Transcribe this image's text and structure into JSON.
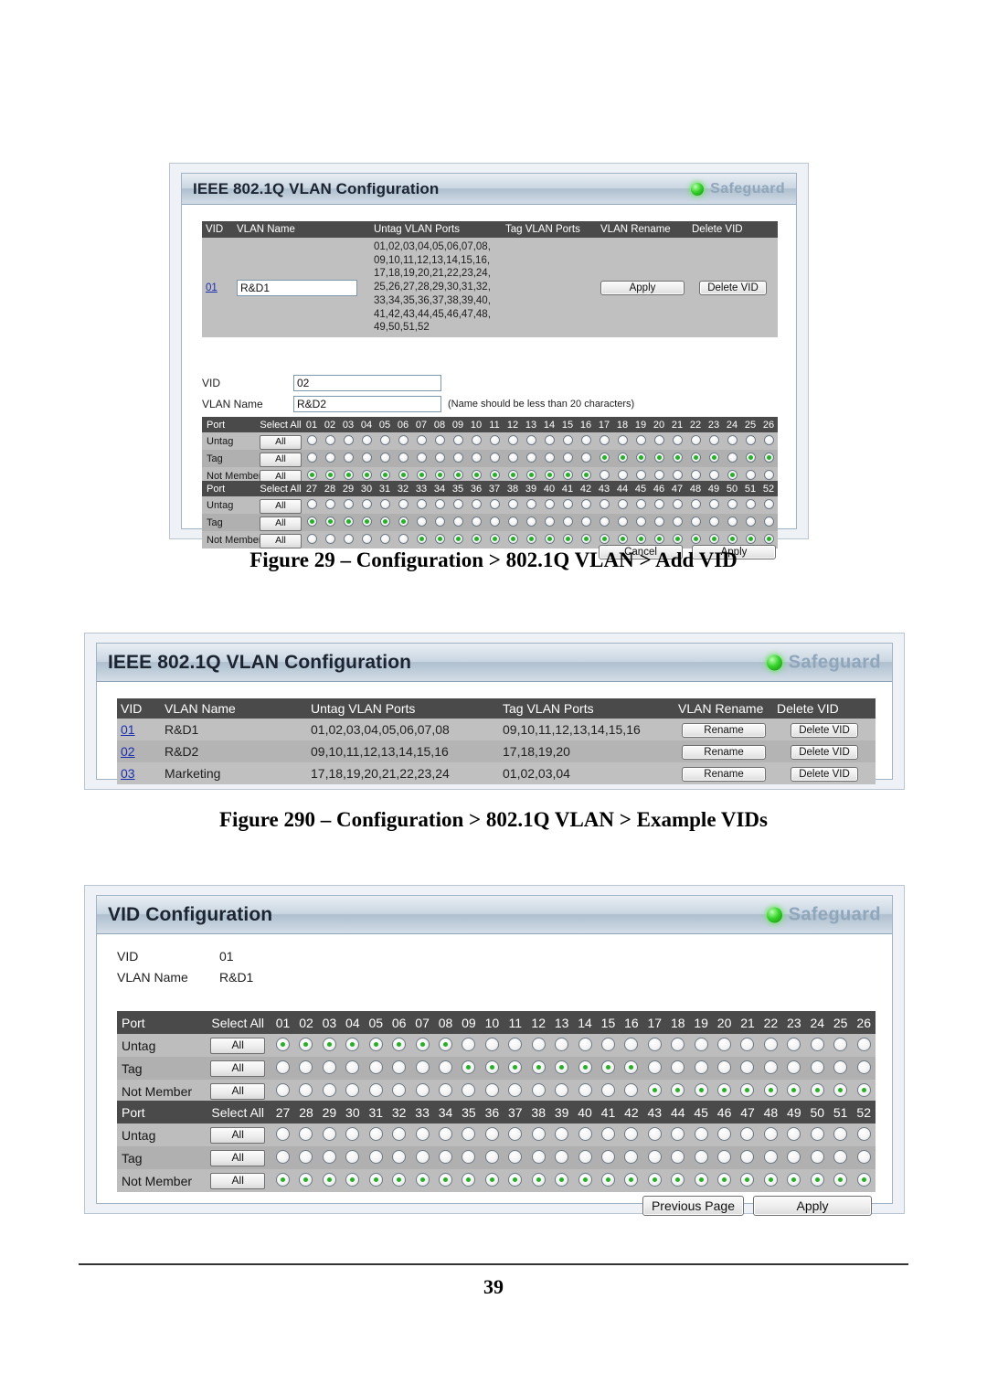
{
  "page": {
    "number": "39"
  },
  "figure1": {
    "panel": {
      "title": "IEEE 802.1Q VLAN Configuration",
      "safeguard_label": "Safeguard",
      "led_color": "#36d42a",
      "title_color": "#1b2430",
      "safeguard_text_color": "#8fa6bb"
    },
    "table": {
      "headers": [
        "VID",
        "VLAN Name",
        "Untag VLAN Ports",
        "Tag VLAN Ports",
        "VLAN Rename",
        "Delete VID"
      ],
      "rows": [
        {
          "vid": "01",
          "vlan_name_value": "R&D1",
          "untag_ports": "01,02,03,04,05,06,07,08,\n09,10,11,12,13,14,15,16,\n17,18,19,20,21,22,23,24,\n25,26,27,28,29,30,31,32,\n33,34,35,36,37,38,39,40,\n41,42,43,44,45,46,47,48,\n49,50,51,52",
          "tag_ports": "",
          "rename_label": "Apply",
          "delete_label": "Delete VID"
        }
      ]
    },
    "form": {
      "vid_label": "VID",
      "vid_value": "02",
      "vlan_name_label": "VLAN Name",
      "vlan_name_value": "R&D2",
      "name_note": "(Name should be less than 20 characters)"
    },
    "matrix": {
      "port_label": "Port",
      "select_all_label": "Select All",
      "all_button_label": "All",
      "row_labels": [
        "Untag",
        "Tag",
        "Not Member"
      ],
      "block1_ports": [
        "01",
        "02",
        "03",
        "04",
        "05",
        "06",
        "07",
        "08",
        "09",
        "10",
        "11",
        "12",
        "13",
        "14",
        "15",
        "16",
        "17",
        "18",
        "19",
        "20",
        "21",
        "22",
        "23",
        "24",
        "25",
        "26"
      ],
      "block2_ports": [
        "27",
        "28",
        "29",
        "30",
        "31",
        "32",
        "33",
        "34",
        "35",
        "36",
        "37",
        "38",
        "39",
        "40",
        "41",
        "42",
        "43",
        "44",
        "45",
        "46",
        "47",
        "48",
        "49",
        "50",
        "51",
        "52"
      ],
      "block1_selection": [
        "N",
        "N",
        "N",
        "N",
        "N",
        "N",
        "N",
        "N",
        "N",
        "N",
        "N",
        "N",
        "N",
        "N",
        "N",
        "N",
        "T",
        "T",
        "T",
        "T",
        "T",
        "T",
        "T",
        "N",
        "T",
        "T"
      ],
      "block2_selection": [
        "T",
        "T",
        "T",
        "T",
        "T",
        "T",
        "N",
        "N",
        "N",
        "N",
        "N",
        "N",
        "N",
        "N",
        "N",
        "N",
        "N",
        "N",
        "N",
        "N",
        "N",
        "N",
        "N",
        "N",
        "N",
        "N"
      ]
    },
    "buttons": {
      "cancel_label": "Cancel",
      "apply_label": "Apply"
    },
    "caption": "Figure 29 – Configuration > 802.1Q VLAN > Add VID"
  },
  "figure2": {
    "panel": {
      "title": "IEEE 802.1Q VLAN Configuration",
      "safeguard_label": "Safeguard"
    },
    "table": {
      "headers": [
        "VID",
        "VLAN Name",
        "Untag VLAN Ports",
        "Tag VLAN Ports",
        "VLAN Rename",
        "Delete VID"
      ],
      "rows": [
        {
          "vid": "01",
          "vlan_name": "R&D1",
          "untag_ports": "01,02,03,04,05,06,07,08",
          "tag_ports": "09,10,11,12,13,14,15,16",
          "rename_label": "Rename",
          "delete_label": "Delete VID"
        },
        {
          "vid": "02",
          "vlan_name": "R&D2",
          "untag_ports": "09,10,11,12,13,14,15,16",
          "tag_ports": "17,18,19,20",
          "rename_label": "Rename",
          "delete_label": "Delete VID"
        },
        {
          "vid": "03",
          "vlan_name": "Marketing",
          "untag_ports": "17,18,19,20,21,22,23,24",
          "tag_ports": "01,02,03,04",
          "rename_label": "Rename",
          "delete_label": "Delete VID"
        }
      ]
    },
    "caption": "Figure 290 – Configuration > 802.1Q VLAN > Example VIDs"
  },
  "figure3": {
    "panel": {
      "title": "VID Configuration",
      "safeguard_label": "Safeguard"
    },
    "info": {
      "vid_label": "VID",
      "vid_value": "01",
      "vlan_name_label": "VLAN Name",
      "vlan_name_value": "R&D1"
    },
    "matrix": {
      "port_label": "Port",
      "select_all_label": "Select All",
      "all_button_label": "All",
      "row_labels": [
        "Untag",
        "Tag",
        "Not Member"
      ],
      "block1_ports": [
        "01",
        "02",
        "03",
        "04",
        "05",
        "06",
        "07",
        "08",
        "09",
        "10",
        "11",
        "12",
        "13",
        "14",
        "15",
        "16",
        "17",
        "18",
        "19",
        "20",
        "21",
        "22",
        "23",
        "24",
        "25",
        "26"
      ],
      "block2_ports": [
        "27",
        "28",
        "29",
        "30",
        "31",
        "32",
        "33",
        "34",
        "35",
        "36",
        "37",
        "38",
        "39",
        "40",
        "41",
        "42",
        "43",
        "44",
        "45",
        "46",
        "47",
        "48",
        "49",
        "50",
        "51",
        "52"
      ],
      "block1_selection": [
        "U",
        "U",
        "U",
        "U",
        "U",
        "U",
        "U",
        "U",
        "T",
        "T",
        "T",
        "T",
        "T",
        "T",
        "T",
        "T",
        "N",
        "N",
        "N",
        "N",
        "N",
        "N",
        "N",
        "N",
        "N",
        "N"
      ],
      "block2_selection": [
        "N",
        "N",
        "N",
        "N",
        "N",
        "N",
        "N",
        "N",
        "N",
        "N",
        "N",
        "N",
        "N",
        "N",
        "N",
        "N",
        "N",
        "N",
        "N",
        "N",
        "N",
        "N",
        "N",
        "N",
        "N",
        "N"
      ]
    },
    "buttons": {
      "previous_label": "Previous Page",
      "apply_label": "Apply"
    }
  }
}
